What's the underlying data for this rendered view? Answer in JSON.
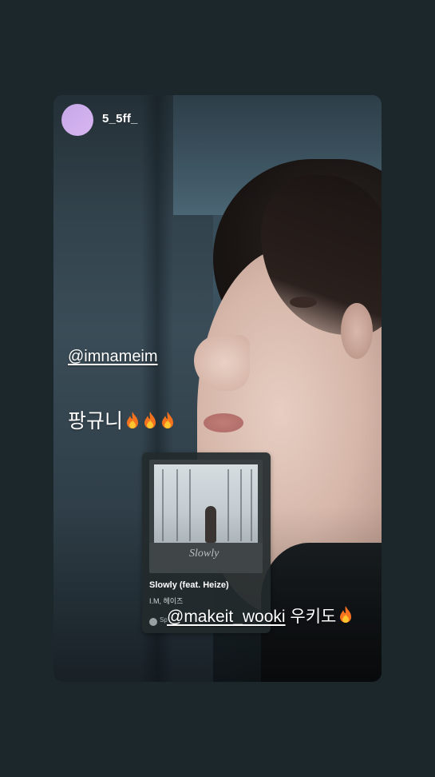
{
  "story": {
    "username": "5_5ff_",
    "mention_1": "@imnameim",
    "caption_1_text": "팡규니",
    "caption_1_emojis": [
      "fire-icon",
      "fire-icon",
      "fire-icon"
    ],
    "music": {
      "album_title": "Slowly",
      "track_title": "Slowly (feat. Heize)",
      "artist": "I.M, 헤이즈",
      "source_label": "Sp"
    },
    "mention_2": "@makeit_wooki",
    "caption_2_text": " 우키도",
    "caption_2_emoji": "fire-icon"
  },
  "colors": {
    "page_bg": "#1c272c",
    "avatar": "#c7a7e8",
    "text": "#ffffff"
  }
}
